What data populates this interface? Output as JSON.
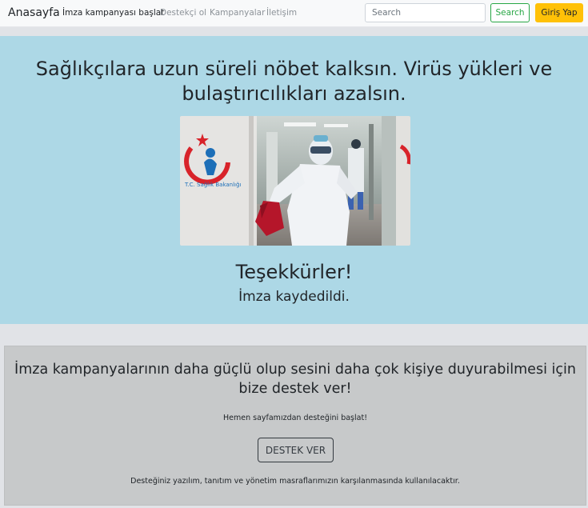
{
  "navbar": {
    "brand": "Anasayfa",
    "links": [
      "İmza kampanyası başlat",
      "Destekçi ol",
      "Kampanyalar",
      "İletişim"
    ],
    "search_placeholder": "Search",
    "search_button": "Search",
    "login_button": "Giriş Yap"
  },
  "hero": {
    "title": "Sağlıkçılara uzun süreli nöbet kalksın. Virüs yükleri ve bulaştırıcılıkları azalsın.",
    "photo_sign_text": "T.C. Sağlık Bakanlığı",
    "thanks": "Teşekkürler!",
    "status": "İmza kaydedildi."
  },
  "support": {
    "title": "İmza kampanyalarının daha güçlü olup sesini daha çok kişiye duyurabilmesi için bize destek ver!",
    "subtitle": "Hemen sayfamızdan desteğini başlat!",
    "button": "DESTEK VER",
    "note": "Desteğiniz yazılım, tanıtım ve yönetim masraflarımızın karşılanmasında kullanılacaktır."
  },
  "colors": {
    "navbar_bg": "#f8f9fa",
    "hero_bg": "#add8e6",
    "support_bg": "#c7c9ca",
    "search_accent": "#28a745",
    "login_accent": "#ffc107"
  }
}
